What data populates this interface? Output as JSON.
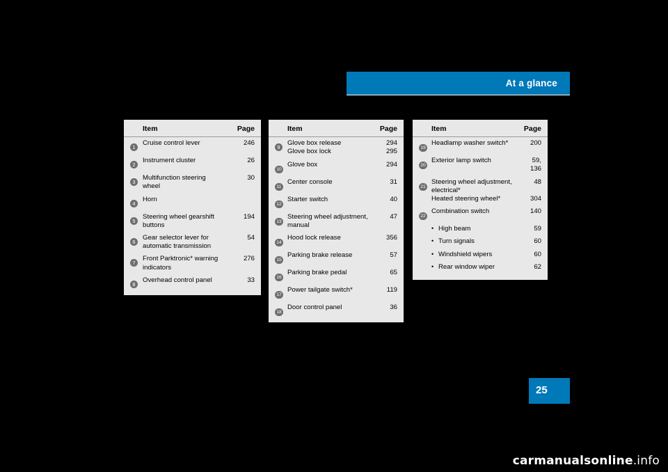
{
  "header": {
    "title": "At a glance",
    "accent_color": "#0079b8"
  },
  "page_number": "25",
  "watermark": {
    "prefix": "carmanualsonline",
    "suffix": ".info"
  },
  "tables": [
    {
      "id": "table-1",
      "headers": {
        "item": "Item",
        "page": "Page"
      },
      "rows": [
        {
          "num": "1",
          "item": [
            "Cruise control lever"
          ],
          "page": [
            "246"
          ]
        },
        {
          "num": "2",
          "item": [
            "Instrument cluster"
          ],
          "page": [
            "26"
          ]
        },
        {
          "num": "3",
          "item": [
            "Multifunction steering",
            "wheel"
          ],
          "page": [
            "30"
          ]
        },
        {
          "num": "4",
          "item": [
            "Horn"
          ],
          "page": [
            ""
          ]
        },
        {
          "num": "5",
          "item": [
            "Steering wheel gearshift",
            "buttons"
          ],
          "page": [
            "194"
          ]
        },
        {
          "num": "6",
          "item": [
            "Gear selector lever for",
            "automatic transmission"
          ],
          "page": [
            "54"
          ]
        },
        {
          "num": "7",
          "item": [
            "Front Parktronic* warning",
            "indicators"
          ],
          "page": [
            "276"
          ]
        },
        {
          "num": "8",
          "item": [
            "Overhead control panel"
          ],
          "page": [
            "33"
          ]
        }
      ]
    },
    {
      "id": "table-2",
      "headers": {
        "item": "Item",
        "page": "Page"
      },
      "rows": [
        {
          "num": "9",
          "item": [
            "Glove box release",
            "Glove box lock"
          ],
          "page": [
            "294",
            "295"
          ]
        },
        {
          "num": "10",
          "item": [
            "Glove box"
          ],
          "page": [
            "294"
          ]
        },
        {
          "num": "11",
          "item": [
            "Center console"
          ],
          "page": [
            "31"
          ]
        },
        {
          "num": "12",
          "item": [
            "Starter switch"
          ],
          "page": [
            "40"
          ]
        },
        {
          "num": "13",
          "item": [
            "Steering wheel adjustment,",
            "manual"
          ],
          "page": [
            "47"
          ]
        },
        {
          "num": "14",
          "item": [
            "Hood lock release"
          ],
          "page": [
            "356"
          ]
        },
        {
          "num": "15",
          "item": [
            "Parking brake release"
          ],
          "page": [
            "57"
          ]
        },
        {
          "num": "16",
          "item": [
            "Parking brake pedal"
          ],
          "page": [
            "65"
          ]
        },
        {
          "num": "17",
          "item": [
            "Power tailgate switch*"
          ],
          "page": [
            "119"
          ]
        },
        {
          "num": "18",
          "item": [
            "Door control panel"
          ],
          "page": [
            "36"
          ]
        }
      ]
    },
    {
      "id": "table-3",
      "headers": {
        "item": "Item",
        "page": "Page"
      },
      "rows": [
        {
          "num": "19",
          "item": [
            "Headlamp washer switch*"
          ],
          "page": [
            "200"
          ]
        },
        {
          "num": "20",
          "item": [
            "Exterior lamp switch"
          ],
          "page": [
            "59,",
            "136"
          ]
        },
        {
          "num": "21",
          "item": [
            "Steering wheel adjustment,",
            "electrical*",
            "Heated steering wheel*"
          ],
          "page": [
            "48",
            "",
            "304"
          ]
        },
        {
          "num": "22",
          "item": [
            "Combination switch"
          ],
          "page": [
            "140"
          ],
          "bullets": [
            {
              "label": "High beam",
              "page": "59"
            },
            {
              "label": "Turn signals",
              "page": "60"
            },
            {
              "label": "Windshield wipers",
              "page": "60"
            },
            {
              "label": "Rear window wiper",
              "page": "62"
            }
          ]
        }
      ]
    }
  ]
}
